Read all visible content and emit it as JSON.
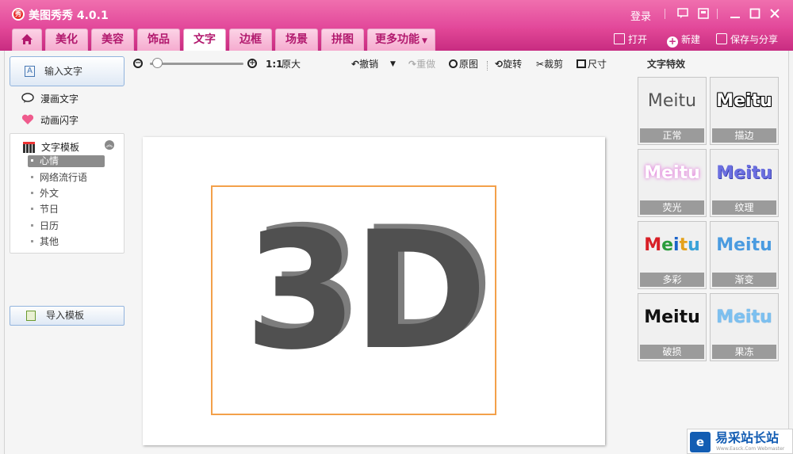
{
  "window": {
    "title": "美图秀秀 4.0.1",
    "login_label": "登录",
    "logo_glyph": "秀"
  },
  "tabs": [
    {
      "label": "美化"
    },
    {
      "label": "美容"
    },
    {
      "label": "饰品"
    },
    {
      "label": "文字",
      "active": true
    },
    {
      "label": "边框"
    },
    {
      "label": "场景"
    },
    {
      "label": "拼图"
    },
    {
      "label": "更多功能"
    }
  ],
  "header_actions": {
    "open": "打开",
    "new": "新建",
    "save_share": "保存与分享"
  },
  "left_panel": {
    "input_text": "输入文字",
    "comic_text": "漫画文字",
    "animated_text": "动画闪字",
    "text_templates": "文字模板",
    "template_items": [
      "心情",
      "网络流行语",
      "外文",
      "节日",
      "日历",
      "其他"
    ],
    "selected_template": "心情",
    "import_template": "导入模板"
  },
  "toolbar": {
    "zoom_ratio": "1:1",
    "original_size": "原大",
    "undo": "撤销",
    "redo": "重做",
    "original_image": "原图",
    "rotate": "旋转",
    "crop": "裁剪",
    "size": "尺寸",
    "zoom_level": 0.05
  },
  "canvas": {
    "text": "3D",
    "front_color": "#505050",
    "shadow_color": "#7d7d7d",
    "selection_color": "#f3a04a"
  },
  "effects": {
    "title": "文字特效",
    "sample_text": "Meitu",
    "items": [
      {
        "label": "正常"
      },
      {
        "label": "描边"
      },
      {
        "label": "荧光"
      },
      {
        "label": "纹理"
      },
      {
        "label": "多彩"
      },
      {
        "label": "渐变"
      },
      {
        "label": "破损"
      },
      {
        "label": "果冻"
      }
    ]
  },
  "watermark": {
    "brand": "易采站长站",
    "sub": "Www.Easck.Com Webmaster",
    "logo_glyph": "e"
  },
  "colors": {
    "brand_pink": "#e2479a",
    "tab_text": "#b2196e",
    "accent_blue": "#135db3"
  }
}
